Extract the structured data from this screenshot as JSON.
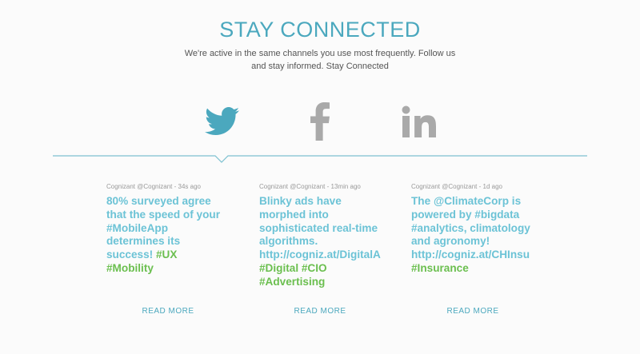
{
  "header": {
    "title": "STAY CONNECTED",
    "subtitle_line1": "We're active in the same channels you use most frequently. Follow us",
    "subtitle_line2": "and stay informed. Stay Connected"
  },
  "social": [
    {
      "name": "twitter",
      "icon": "twitter-bird-icon",
      "active": true,
      "color": "#4ba8be"
    },
    {
      "name": "facebook",
      "icon": "facebook-f-icon",
      "active": false,
      "color": "#a9a9a9"
    },
    {
      "name": "linkedin",
      "icon": "linkedin-in-icon",
      "active": false,
      "color": "#a9a9a9"
    }
  ],
  "tweets": [
    {
      "meta": "Cognizant @Cognizant - 34s ago",
      "lines": [
        [
          {
            "text": "80% surveyed agree",
            "tag": false
          }
        ],
        [
          {
            "text": "that the speed of your",
            "tag": false
          }
        ],
        [
          {
            "text": "#MobileApp",
            "tag": false
          }
        ],
        [
          {
            "text": "determines its",
            "tag": false
          }
        ],
        [
          {
            "text": "success! ",
            "tag": false
          },
          {
            "text": "#UX",
            "tag": true
          }
        ],
        [
          {
            "text": "#Mobility",
            "tag": true
          }
        ]
      ],
      "read_more": "READ MORE"
    },
    {
      "meta": "Cognizant @Cognizant - 13min ago",
      "lines": [
        [
          {
            "text": "Blinky ads have",
            "tag": false
          }
        ],
        [
          {
            "text": "morphed into",
            "tag": false
          }
        ],
        [
          {
            "text": "sophisticated real-time",
            "tag": false
          }
        ],
        [
          {
            "text": "algorithms.",
            "tag": false
          }
        ],
        [
          {
            "text": "http://cogniz.at/DigitalA",
            "tag": false
          }
        ],
        [
          {
            "text": "#Digital #CIO",
            "tag": true
          }
        ],
        [
          {
            "text": "#Advertising",
            "tag": true
          }
        ]
      ],
      "read_more": "READ MORE"
    },
    {
      "meta": "Cognizant @Cognizant - 1d ago",
      "lines": [
        [
          {
            "text": "The @ClimateCorp is",
            "tag": false
          }
        ],
        [
          {
            "text": "powered by #bigdata",
            "tag": false
          }
        ],
        [
          {
            "text": "#analytics, climatology",
            "tag": false
          }
        ],
        [
          {
            "text": "and agronomy!",
            "tag": false
          }
        ],
        [
          {
            "text": "http://cogniz.at/CHInsu",
            "tag": false
          }
        ],
        [
          {
            "text": "#Insurance",
            "tag": true
          }
        ]
      ],
      "read_more": "READ MORE"
    }
  ],
  "colors": {
    "accent": "#4ba8be",
    "tweet_text": "#6cc3d6",
    "hashtag": "#6bbf4f",
    "inactive_icon": "#a9a9a9"
  }
}
